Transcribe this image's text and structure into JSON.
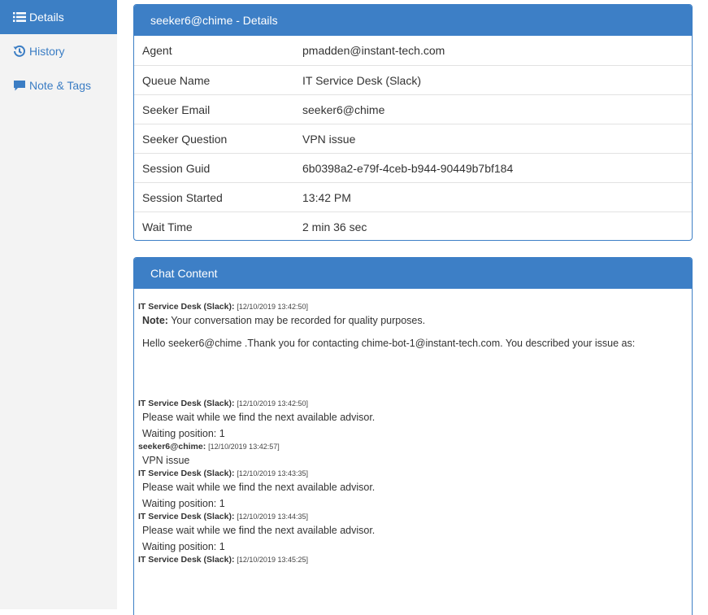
{
  "sidebar": {
    "items": [
      {
        "label": "Details",
        "icon": "list-icon",
        "active": true
      },
      {
        "label": "History",
        "icon": "clock-icon",
        "active": false
      },
      {
        "label": "Note & Tags",
        "icon": "comment-icon",
        "active": false
      }
    ]
  },
  "details": {
    "title": "seeker6@chime - Details",
    "rows": [
      {
        "label": "Agent",
        "value": "pmadden@instant-tech.com"
      },
      {
        "label": "Queue Name",
        "value": "IT Service Desk (Slack)"
      },
      {
        "label": "Seeker Email",
        "value": "seeker6@chime"
      },
      {
        "label": "Seeker Question",
        "value": "VPN issue"
      },
      {
        "label": "Session Guid",
        "value": "6b0398a2-e79f-4ceb-b944-90449b7bf184"
      },
      {
        "label": "Session Started",
        "value": "13:42 PM"
      },
      {
        "label": "Wait Time",
        "value": "2 min 36 sec"
      }
    ]
  },
  "chat": {
    "title": "Chat Content",
    "messages": [
      {
        "sender": "IT Service Desk (Slack):",
        "time": "[12/10/2019 13:42:50]",
        "note_label": "Note:",
        "note_text": " Your conversation may be recorded for quality purposes.",
        "lines": [
          "Hello seeker6@chime .Thank you for contacting chime-bot-1@instant-tech.com. You described your issue as:"
        ]
      },
      {
        "sender": "IT Service Desk (Slack):",
        "time": "[12/10/2019 13:42:50]",
        "lines": [
          "Please wait while we find the next available advisor.",
          "Waiting position: 1"
        ]
      },
      {
        "sender": "seeker6@chime:",
        "time": "[12/10/2019 13:42:57]",
        "lines": [
          "VPN issue"
        ]
      },
      {
        "sender": "IT Service Desk (Slack):",
        "time": "[12/10/2019 13:43:35]",
        "lines": [
          "Please wait while we find the next available advisor.",
          "Waiting position: 1"
        ]
      },
      {
        "sender": "IT Service Desk (Slack):",
        "time": "[12/10/2019 13:44:35]",
        "lines": [
          "Please wait while we find the next available advisor.",
          "Waiting position: 1"
        ]
      },
      {
        "sender": "IT Service Desk (Slack):",
        "time": "[12/10/2019 13:45:25]",
        "lines": []
      }
    ]
  },
  "colors": {
    "accent": "#3d7fc6",
    "sidebar_bg": "#f3f3f3",
    "link": "#3b7dc4"
  }
}
